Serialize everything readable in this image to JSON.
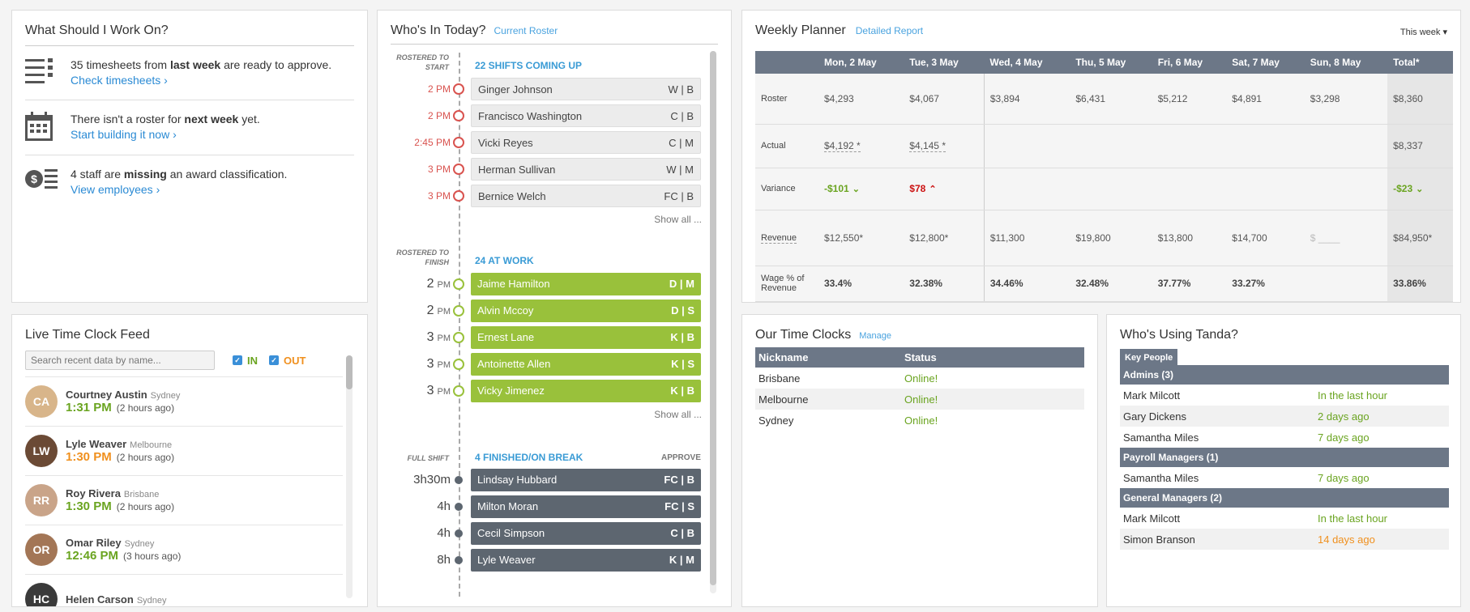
{
  "todo": {
    "title": "What Should I Work On?",
    "items": [
      {
        "pre": "35 timesheets from ",
        "bold": "last week",
        "post": " are ready to approve.",
        "link": "Check timesheets ›",
        "icon": "list-icon"
      },
      {
        "pre": "There isn't a roster for ",
        "bold": "next week",
        "post": " yet.",
        "link": "Start building it now ›",
        "icon": "calendar-icon"
      },
      {
        "pre": "4 staff are ",
        "bold": "missing",
        "post": " an award classification.",
        "link": "View employees ›",
        "icon": "dollar-list-icon"
      }
    ]
  },
  "feed": {
    "title": "Live Time Clock Feed",
    "search_placeholder": "Search recent data by name...",
    "in_label": "IN",
    "out_label": "OUT",
    "rows": [
      {
        "name": "Courtney Austin",
        "loc": "Sydney",
        "time": "1:31 PM",
        "ago": "(2 hours ago)",
        "kind": "in"
      },
      {
        "name": "Lyle Weaver",
        "loc": "Melbourne",
        "time": "1:30 PM",
        "ago": "(2 hours ago)",
        "kind": "out"
      },
      {
        "name": "Roy Rivera",
        "loc": "Brisbane",
        "time": "1:30 PM",
        "ago": "(2 hours ago)",
        "kind": "in"
      },
      {
        "name": "Omar Riley",
        "loc": "Sydney",
        "time": "12:46 PM",
        "ago": "(3 hours ago)",
        "kind": "in"
      },
      {
        "name": "Helen Carson",
        "loc": "Sydney",
        "time": "",
        "ago": "",
        "kind": "in"
      }
    ]
  },
  "whos": {
    "title": "Who's In Today?",
    "sub": "Current Roster",
    "upcoming": {
      "label": "ROSTERED TO START",
      "title": "22 SHIFTS COMING UP",
      "rows": [
        {
          "time": "2 PM",
          "name": "Ginger Johnson",
          "tag": "W | B"
        },
        {
          "time": "2 PM",
          "name": "Francisco Washington",
          "tag": "C | B"
        },
        {
          "time": "2:45 PM",
          "name": "Vicki Reyes",
          "tag": "C | M"
        },
        {
          "time": "3 PM",
          "name": "Herman Sullivan",
          "tag": "W | M"
        },
        {
          "time": "3 PM",
          "name": "Bernice Welch",
          "tag": "FC | B"
        }
      ]
    },
    "work": {
      "label": "ROSTERED TO FINISH",
      "title": "24 AT WORK",
      "rows": [
        {
          "time": "2",
          "unit": "PM",
          "name": "Jaime Hamilton",
          "tag": "D | M"
        },
        {
          "time": "2",
          "unit": "PM",
          "name": "Alvin Mccoy",
          "tag": "D | S"
        },
        {
          "time": "3",
          "unit": "PM",
          "name": "Ernest Lane",
          "tag": "K | B"
        },
        {
          "time": "3",
          "unit": "PM",
          "name": "Antoinette Allen",
          "tag": "K | S"
        },
        {
          "time": "3",
          "unit": "PM",
          "name": "Vicky Jimenez",
          "tag": "K | B"
        }
      ]
    },
    "finished": {
      "label": "FULL SHIFT",
      "title": "4 FINISHED/ON BREAK",
      "approve": "APPROVE",
      "rows": [
        {
          "time": "3h30m",
          "name": "Lindsay Hubbard",
          "tag": "FC | B"
        },
        {
          "time": "4h",
          "name": "Milton Moran",
          "tag": "FC | S"
        },
        {
          "time": "4h",
          "name": "Cecil Simpson",
          "tag": "C | B"
        },
        {
          "time": "8h",
          "name": "Lyle Weaver",
          "tag": "K | M"
        }
      ]
    },
    "show_all": "Show all ..."
  },
  "planner": {
    "title": "Weekly Planner",
    "sub": "Detailed Report",
    "range": "This week ▾",
    "headers": [
      "",
      "Mon, 2 May",
      "Tue, 3 May",
      "Wed, 4 May",
      "Thu, 5 May",
      "Fri, 6 May",
      "Sat, 7 May",
      "Sun, 8 May",
      "Total*"
    ],
    "roster": [
      "Roster",
      "$4,293",
      "$4,067",
      "$3,894",
      "$6,431",
      "$5,212",
      "$4,891",
      "$3,298",
      "$8,360"
    ],
    "actual": [
      "Actual",
      "$4,192 *",
      "$4,145 *",
      "",
      "",
      "",
      "",
      "",
      "$8,337"
    ],
    "variance": [
      "Variance",
      "-$101",
      "$78",
      "",
      "",
      "",
      "",
      "",
      "-$23"
    ],
    "revenue": [
      "Revenue",
      "$12,550*",
      "$12,800*",
      "$11,300",
      "$19,800",
      "$13,800",
      "$14,700",
      "$ ____",
      "$84,950*"
    ],
    "wage": [
      "Wage % of Revenue",
      "33.4%",
      "32.38%",
      "34.46%",
      "32.48%",
      "37.77%",
      "33.27%",
      "",
      "33.86%"
    ]
  },
  "clocks": {
    "title": "Our Time Clocks",
    "sub": "Manage",
    "headers": [
      "Nickname",
      "Status"
    ],
    "rows": [
      {
        "name": "Brisbane",
        "status": "Online!"
      },
      {
        "name": "Melbourne",
        "status": "Online!"
      },
      {
        "name": "Sydney",
        "status": "Online!"
      }
    ]
  },
  "tanda": {
    "title": "Who's Using Tanda?",
    "key": "Key People",
    "groups": [
      {
        "name": "Admins (3)",
        "rows": [
          {
            "name": "Mark Milcott",
            "when": "In the last hour",
            "color": "green"
          },
          {
            "name": "Gary Dickens",
            "when": "2 days ago",
            "color": "green"
          },
          {
            "name": "Samantha Miles",
            "when": "7 days ago",
            "color": "green"
          }
        ]
      },
      {
        "name": "Payroll Managers (1)",
        "rows": [
          {
            "name": "Samantha Miles",
            "when": "7 days ago",
            "color": "green"
          }
        ]
      },
      {
        "name": "General Managers (2)",
        "rows": [
          {
            "name": "Mark Milcott",
            "when": "In the last hour",
            "color": "green"
          },
          {
            "name": "Simon Branson",
            "when": "14 days ago",
            "color": "orange"
          }
        ]
      }
    ]
  },
  "colors": {
    "accent": "#4aa3df",
    "green": "#99c13b",
    "slate": "#5d6670",
    "red": "#d9534f",
    "orange": "#f0901e"
  }
}
